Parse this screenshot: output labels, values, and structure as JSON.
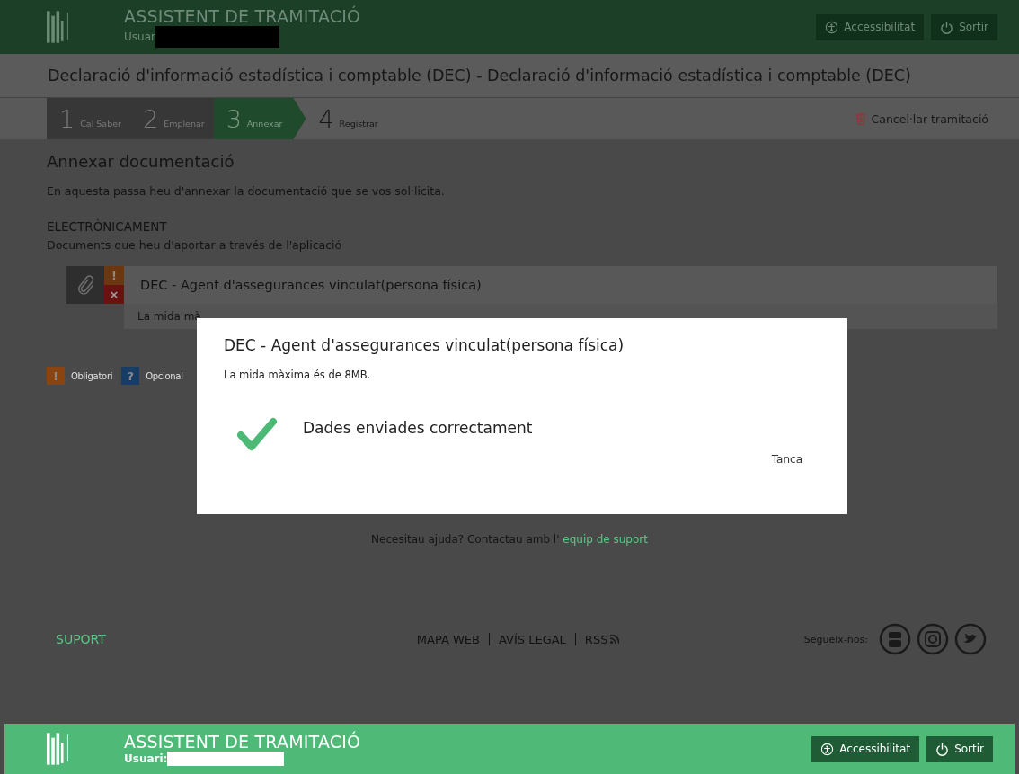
{
  "header": {
    "title": "ASSISTENT DE TRAMITACIÓ",
    "user_label": "Usuar",
    "buttons": [
      {
        "kind": "accessibility",
        "label": "Accessibilitat"
      },
      {
        "kind": "power",
        "label": "Sortir"
      }
    ]
  },
  "page_title": "Declaració d'informació estadística i comptable (DEC) - Declaració d'informació estadística i comptable (DEC)",
  "steps": [
    {
      "number": "1",
      "label": "Cal Saber",
      "selected": false,
      "completed": true
    },
    {
      "number": "2",
      "label": "Emplenar",
      "selected": false,
      "completed": true
    },
    {
      "number": "3",
      "label": "Annexar",
      "selected": true,
      "completed": false
    },
    {
      "number": "4",
      "label": "Registrar",
      "selected": false,
      "completed": false
    }
  ],
  "cancel": "Cancel·lar tramitació",
  "section": {
    "heading": "Annexar documentació",
    "intro": "En aquesta passa heu d'annexar la documentació que se vos sol·licita.",
    "subheading": "ELECTRÒNICAMENT",
    "subtext": "Documents que heu d'aportar a través de l'aplicació"
  },
  "document": {
    "title": "DEC - Agent d'assegurances vinculat(persona física)",
    "mandatory_mark": "!",
    "remove_mark": "×",
    "note": "La mida mà"
  },
  "legend": [
    {
      "mark": "!",
      "label": "Obligatori",
      "color": "#8a4410"
    },
    {
      "mark": "?",
      "label": "Opcional",
      "color": "#173d66"
    }
  ],
  "help": {
    "text": "Necesitau ajuda? Contactau amb l'",
    "link": "equip de suport"
  },
  "footer": {
    "suport": "SUPORT",
    "links": [
      "MAPA WEB",
      "AVÍS LEGAL",
      "RSS"
    ],
    "follow": "Segueix-nos:"
  },
  "bottom_bar": {
    "title": "ASSISTENT DE TRAMITACIÓ",
    "user_label": "Usuari:",
    "buttons": [
      {
        "kind": "accessibility",
        "label": "Accessibilitat"
      },
      {
        "kind": "power",
        "label": "Sortir"
      }
    ]
  },
  "modal": {
    "title": "DEC - Agent d'assegurances vinculat(persona física)",
    "note": "La mida màxima és de 8MB.",
    "message": "Dades enviades correctament",
    "close": "Tanca"
  }
}
